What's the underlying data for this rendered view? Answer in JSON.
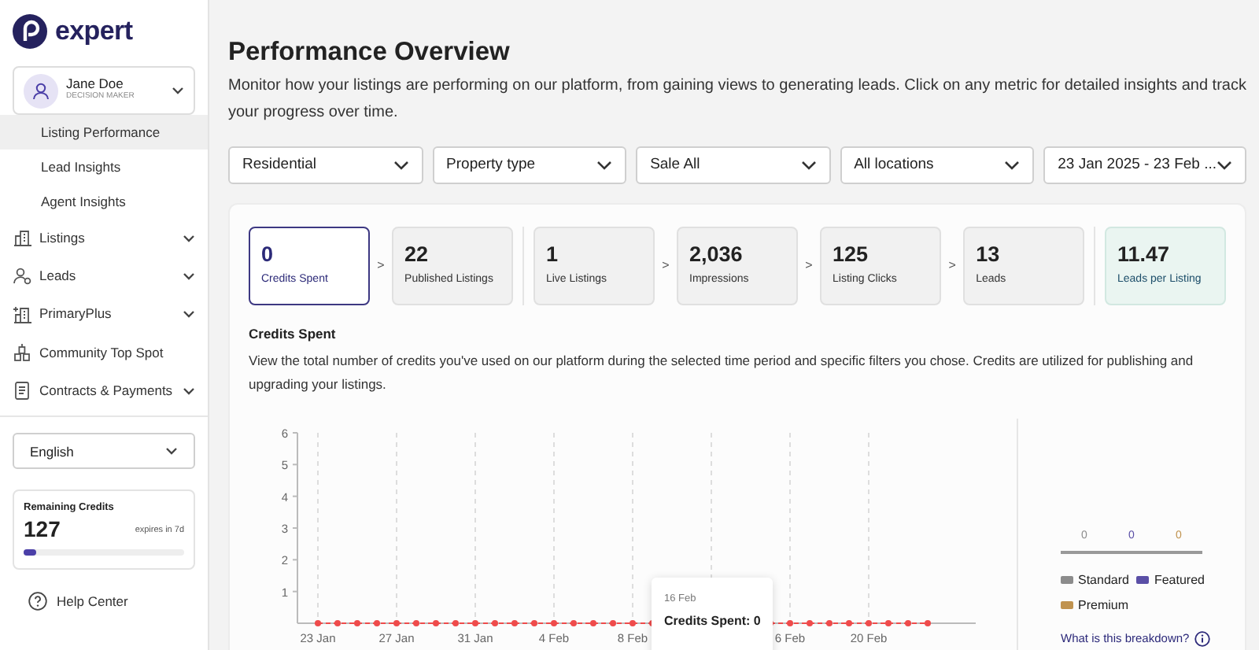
{
  "logo": {
    "text": "expert"
  },
  "user": {
    "name": "Jane Doe",
    "role": "DECISION MAKER"
  },
  "nav": [
    {
      "label": "Listing Performance",
      "kind": "sub",
      "selected": true,
      "expandable": false
    },
    {
      "label": "Lead Insights",
      "kind": "sub",
      "selected": false,
      "expandable": false
    },
    {
      "label": "Agent Insights",
      "kind": "sub",
      "selected": false,
      "expandable": false
    },
    {
      "label": "Listings",
      "kind": "section",
      "selected": false,
      "expandable": true
    },
    {
      "label": "Leads",
      "kind": "section",
      "selected": false,
      "expandable": true
    },
    {
      "label": "PrimaryPlus",
      "kind": "section",
      "selected": false,
      "expandable": true
    },
    {
      "label": "Community Top Spot",
      "kind": "section",
      "selected": false,
      "expandable": false
    },
    {
      "label": "Contracts & Payments",
      "kind": "section",
      "selected": false,
      "expandable": true
    }
  ],
  "language": {
    "value": "English"
  },
  "credits": {
    "title": "Remaining Credits",
    "value": "127",
    "expiry": "expires in 7d",
    "level": 0.08
  },
  "help": {
    "label": "Help Center"
  },
  "page": {
    "title": "Performance Overview",
    "description": "Monitor how your listings are performing on our platform, from gaining views to generating leads. Click on any metric for detailed insights and track your progress over time."
  },
  "filters": [
    {
      "value": "Residential"
    },
    {
      "value": "Property type"
    },
    {
      "value": "Sale All"
    },
    {
      "value": "All locations"
    },
    {
      "value": "23 Jan 2025 - 23 Feb ..."
    }
  ],
  "metrics": [
    {
      "value": "0",
      "label": "Credits Spent",
      "selected": true,
      "kind": "count"
    },
    {
      "value": "22",
      "label": "Published Listings",
      "selected": false,
      "kind": "count",
      "arrow": ">"
    },
    {
      "value": "1",
      "label": "Live Listings",
      "selected": false,
      "kind": "count",
      "divider": true
    },
    {
      "value": "2,036",
      "label": "Impressions",
      "selected": false,
      "kind": "count",
      "arrow": ">"
    },
    {
      "value": "125",
      "label": "Listing Clicks",
      "selected": false,
      "kind": "count",
      "arrow": ">"
    },
    {
      "value": "13",
      "label": "Leads",
      "selected": false,
      "kind": "count",
      "arrow": ">"
    },
    {
      "value": "11.47",
      "label": "Leads per Listing",
      "selected": false,
      "kind": "ratio",
      "divider": true
    }
  ],
  "section": {
    "title": "Credits Spent",
    "description": "View the total number of credits you've used on our platform during the selected time period and specific filters you chose. Credits are utilized for publishing and upgrading your listings.",
    "chart_data": {
      "type": "line",
      "categories": [
        "23 Jan",
        null,
        null,
        null,
        "27 Jan",
        null,
        null,
        null,
        "31 Jan",
        null,
        null,
        null,
        "4 Feb",
        null,
        null,
        null,
        "8 Feb",
        null,
        null,
        null,
        null,
        null,
        null,
        null,
        "6 Feb",
        null,
        null,
        null,
        "20 Feb",
        null,
        null,
        null
      ],
      "series": [
        {
          "color": "#ef4b4b",
          "line_style": "dashed",
          "marker": "circle",
          "values": [
            0,
            0,
            0,
            0,
            0,
            0,
            0,
            0,
            0,
            0,
            0,
            0,
            0,
            0,
            0,
            0,
            0,
            0,
            null,
            null,
            null,
            null,
            null,
            0,
            0,
            0,
            0,
            0,
            0,
            0,
            0,
            0
          ]
        }
      ],
      "grid": true,
      "ylim": [
        0,
        6
      ],
      "yticks": [
        1,
        2,
        3,
        4,
        5,
        6
      ]
    },
    "tooltip": {
      "date": "16 Feb",
      "text": "Credits Spent: 0"
    },
    "breakdown": {
      "values": [
        {
          "value": "0",
          "color": "#8c8c8c"
        },
        {
          "value": "0",
          "color": "#5a4fa6"
        },
        {
          "value": "0",
          "color": "#c0934f"
        }
      ],
      "legend": [
        {
          "label": "Standard",
          "color": "#8c8c8c"
        },
        {
          "label": "Featured",
          "color": "#5a4fa6"
        },
        {
          "label": "Premium",
          "color": "#c0934f"
        }
      ],
      "link": "What is this breakdown?"
    }
  }
}
